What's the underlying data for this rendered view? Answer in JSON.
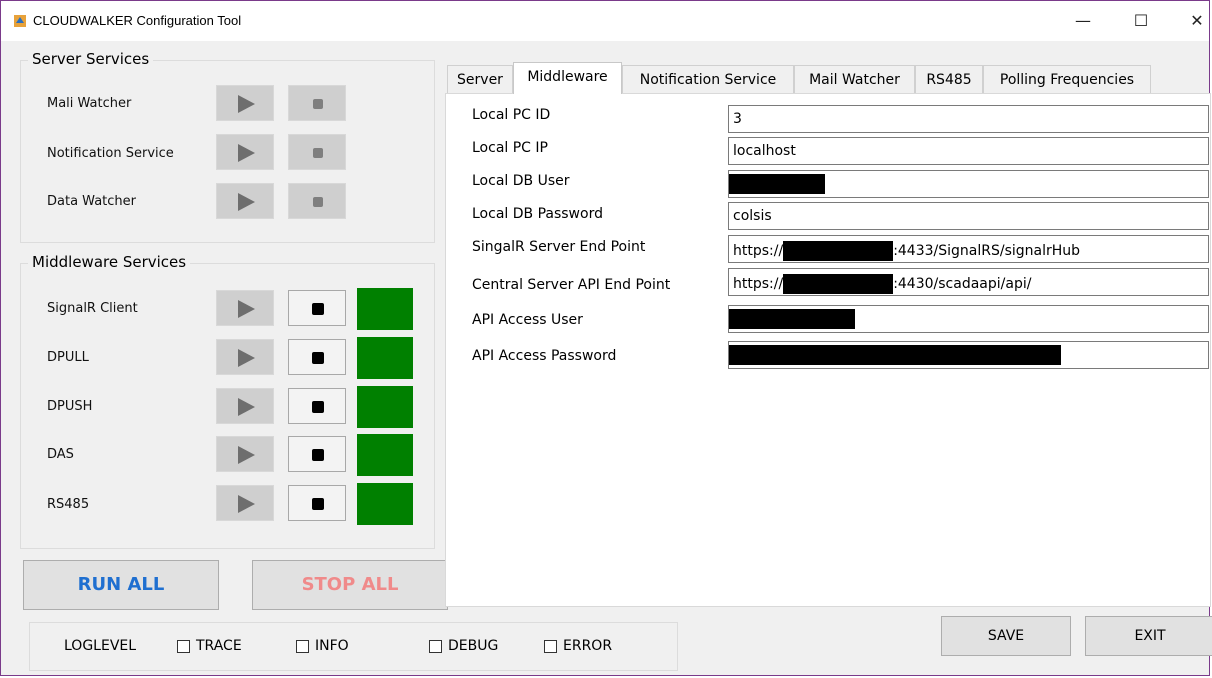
{
  "window": {
    "title": "CLOUDWALKER Configuration Tool",
    "controls": {
      "minimize": "—",
      "maximize": "☐",
      "close": "✕"
    }
  },
  "server_services": {
    "legend": "Server Services",
    "items": [
      {
        "label": "Mali Watcher"
      },
      {
        "label": "Notification Service"
      },
      {
        "label": "Data Watcher"
      }
    ]
  },
  "middleware_services": {
    "legend": "Middleware Services",
    "status_color": "#008000",
    "items": [
      {
        "label": "SignalR Client",
        "status": "running"
      },
      {
        "label": "DPULL",
        "status": "running"
      },
      {
        "label": "DPUSH",
        "status": "running"
      },
      {
        "label": "DAS",
        "status": "running"
      },
      {
        "label": "RS485",
        "status": "running"
      }
    ]
  },
  "actions": {
    "run_all": "RUN ALL",
    "stop_all": "STOP ALL",
    "save": "SAVE",
    "exit": "EXIT"
  },
  "tabs": [
    {
      "label": "Server",
      "active": false
    },
    {
      "label": "Middleware",
      "active": true
    },
    {
      "label": "Notification Service",
      "active": false
    },
    {
      "label": "Mail Watcher",
      "active": false
    },
    {
      "label": "RS485",
      "active": false
    },
    {
      "label": "Polling Frequencies",
      "active": false
    }
  ],
  "middleware_form": {
    "fields": [
      {
        "label": "Local PC ID",
        "value": "3"
      },
      {
        "label": "Local PC IP",
        "value": "localhost"
      },
      {
        "label": "Local DB User",
        "value": ""
      },
      {
        "label": "Local DB Password",
        "value": "colsis"
      },
      {
        "label": "SingalR Server End Point",
        "value_prefix": "https://",
        "value_suffix": ":4433/SignalRS/signalrHub"
      },
      {
        "label": "Central Server API End Point",
        "value_prefix": "https://",
        "value_suffix": ":4430/scadaapi/api/"
      },
      {
        "label": "API Access User",
        "value": ""
      },
      {
        "label": "API Access Password",
        "value": ""
      }
    ]
  },
  "loglevel": {
    "label": "LOGLEVEL",
    "options": [
      {
        "label": "TRACE",
        "checked": false
      },
      {
        "label": "INFO",
        "checked": false
      },
      {
        "label": "DEBUG",
        "checked": false
      },
      {
        "label": "ERROR",
        "checked": false
      }
    ]
  },
  "colors": {
    "run_all_text": "#1f6fd0",
    "stop_all_text": "#f08a8a",
    "status_running": "#008000"
  }
}
